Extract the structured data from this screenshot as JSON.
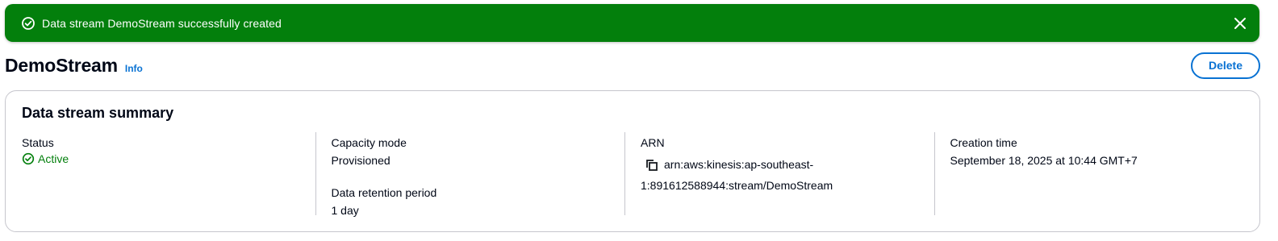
{
  "flash": {
    "message": "Data stream DemoStream successfully created",
    "icon": "check-circle-icon",
    "close_icon": "close-icon",
    "color": "#037f0c"
  },
  "header": {
    "title": "DemoStream",
    "info_label": "Info",
    "delete_label": "Delete"
  },
  "summary": {
    "title": "Data stream summary",
    "status": {
      "label": "Status",
      "value": "Active",
      "color": "#037f0c"
    },
    "capacity": {
      "label": "Capacity mode",
      "value": "Provisioned"
    },
    "retention": {
      "label": "Data retention period",
      "value": "1 day"
    },
    "arn": {
      "label": "ARN",
      "value_line1": "arn:aws:kinesis:ap-southeast-",
      "value_line2": "1:891612588944:stream/DemoStream"
    },
    "creation": {
      "label": "Creation time",
      "value": "September 18, 2025 at 10:44 GMT+7"
    }
  },
  "colors": {
    "link": "#0972d3",
    "border": "#c6c6cd"
  }
}
